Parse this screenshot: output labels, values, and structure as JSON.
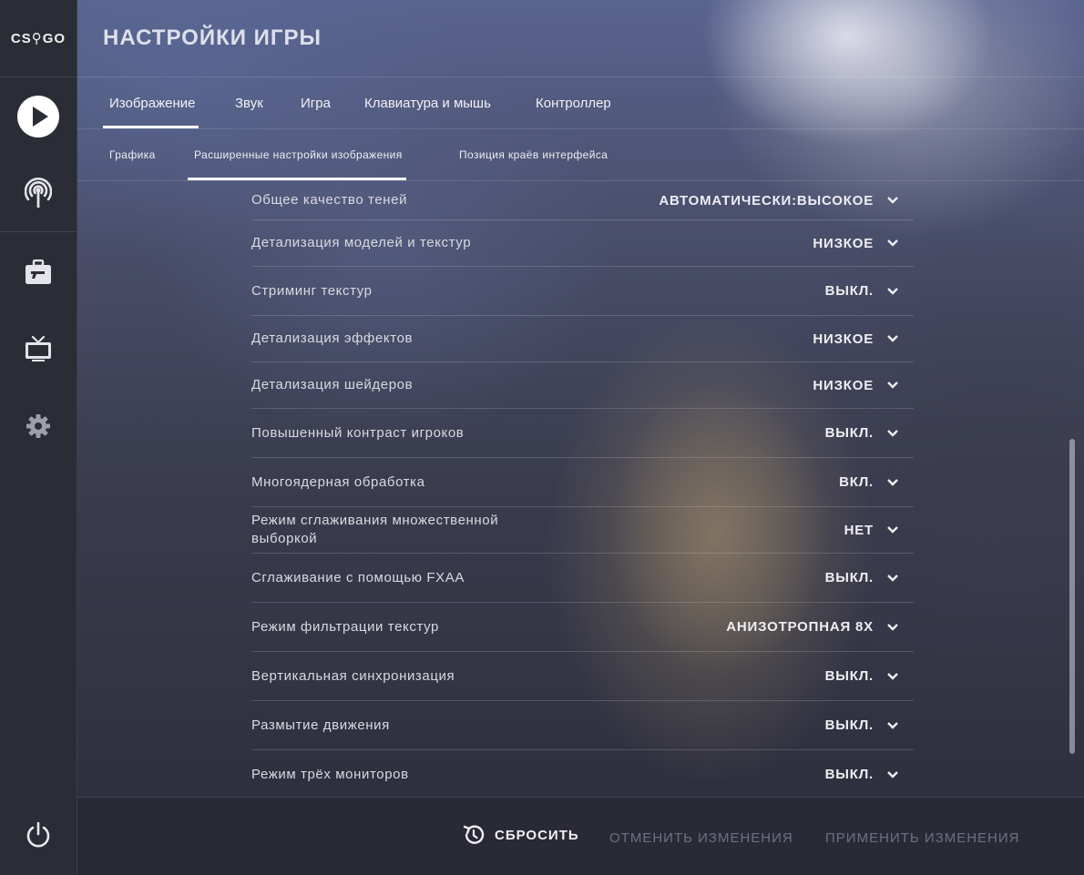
{
  "logo": {
    "text": "CS⚲GO"
  },
  "header": {
    "title": "НАСТРОЙКИ ИГРЫ"
  },
  "sidebar": {
    "items": [
      {
        "icon": "play-icon"
      },
      {
        "icon": "broadcast-icon"
      },
      {
        "icon": "briefcase-icon"
      },
      {
        "icon": "tv-icon"
      },
      {
        "icon": "gear-icon"
      },
      {
        "icon": "power-icon"
      }
    ]
  },
  "tabs": [
    {
      "label": "Изображение",
      "active": true
    },
    {
      "label": "Звук",
      "active": false
    },
    {
      "label": "Игра",
      "active": false
    },
    {
      "label": "Клавиатура и мышь",
      "active": false
    },
    {
      "label": "Контроллер",
      "active": false
    }
  ],
  "subtabs": [
    {
      "label": "Графика",
      "active": false
    },
    {
      "label": "Расширенные настройки изображения",
      "active": true
    },
    {
      "label": "Позиция краёв интерфейса",
      "active": false
    }
  ],
  "settings": [
    {
      "label": "Общее качество теней",
      "value": "АВТОМАТИЧЕСКИ:ВЫСОКОЕ"
    },
    {
      "label": "Детализация моделей и текстур",
      "value": "НИЗКОЕ"
    },
    {
      "label": "Стриминг текстур",
      "value": "ВЫКЛ."
    },
    {
      "label": "Детализация эффектов",
      "value": "НИЗКОЕ"
    },
    {
      "label": "Детализация шейдеров",
      "value": "НИЗКОЕ"
    },
    {
      "label": "Повышенный контраст игроков",
      "value": "ВЫКЛ."
    },
    {
      "label": "Многоядерная обработка",
      "value": "ВКЛ."
    },
    {
      "label": "Режим сглаживания множественной выборкой",
      "value": "НЕТ"
    },
    {
      "label": "Сглаживание с помощью FXAA",
      "value": "ВЫКЛ."
    },
    {
      "label": "Режим фильтрации текстур",
      "value": "АНИЗОТРОПНАЯ 8X"
    },
    {
      "label": "Вертикальная синхронизация",
      "value": "ВЫКЛ."
    },
    {
      "label": "Размытие движения",
      "value": "ВЫКЛ."
    },
    {
      "label": "Режим трёх мониторов",
      "value": "ВЫКЛ."
    }
  ],
  "footer": {
    "reset_label": "СБРОСИТЬ",
    "cancel_label": "ОТМЕНИТЬ ИЗМЕНЕНИЯ",
    "apply_label": "ПРИМЕНИТЬ ИЗМЕНЕНИЯ"
  }
}
